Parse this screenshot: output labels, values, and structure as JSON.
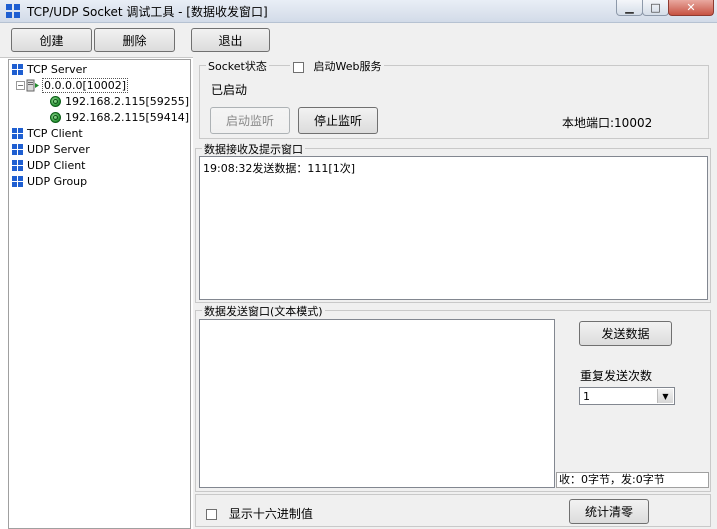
{
  "window": {
    "title": "TCP/UDP Socket 调试工具 - [数据收发窗口]",
    "min_glyph": "▁",
    "max_glyph": "□",
    "close_glyph": "✕"
  },
  "toolbar": {
    "create_label": "创建",
    "delete_label": "删除",
    "exit_label": "退出"
  },
  "tree": {
    "tcp_server": "TCP Server",
    "listener": "0.0.0.0[10002]",
    "clients": [
      "192.168.2.115[59255]",
      "192.168.2.115[59414]"
    ],
    "tcp_client": "TCP Client",
    "udp_server": "UDP Server",
    "udp_client": "UDP Client",
    "udp_group": "UDP Group"
  },
  "socket_status": {
    "legend": "Socket状态",
    "web_service_label": "启动Web服务",
    "web_service_checked": false,
    "state_text": "已启动",
    "start_listen_label": "启动监听",
    "stop_listen_label": "停止监听",
    "local_port_text": "本地端口:10002"
  },
  "receive": {
    "legend": "数据接收及提示窗口",
    "log": "19:08:32发送数据：111[1次]"
  },
  "send": {
    "legend": "数据发送窗口(文本模式)",
    "input_value": "",
    "send_button_label": "发送数据",
    "repeat_label": "重复发送次数",
    "repeat_value": "1",
    "stats_text": "收：0字节，发:0字节"
  },
  "bottom": {
    "hex_label": "显示十六进制值",
    "hex_checked": false,
    "clear_stats_label": "统计清零"
  },
  "colors": {
    "panel_bg": "#f0f0f0",
    "icon_blue": "#1f5fd1",
    "icon_green": "#1f8a2b"
  }
}
